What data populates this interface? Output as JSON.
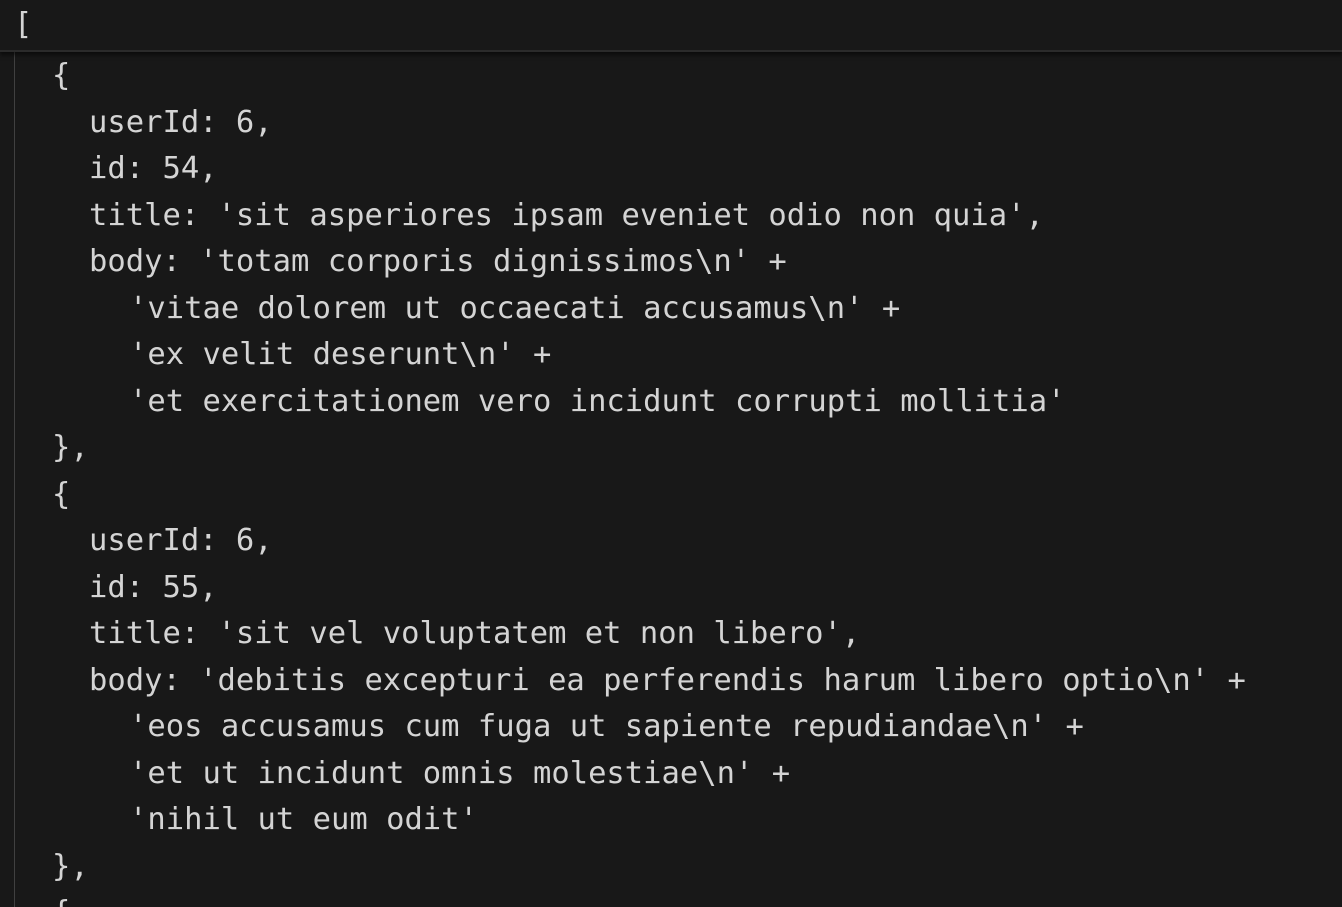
{
  "editor": {
    "sticky_line": "[",
    "lines": [
      "{",
      "userId: 6,",
      "id: 54,",
      "title: 'sit asperiores ipsam eveniet odio non quia',",
      "body: 'totam corporis dignissimos\\n' +",
      "'vitae dolorem ut occaecati accusamus\\n' +",
      "'ex velit deserunt\\n' +",
      "'et exercitationem vero incidunt corrupti mollitia'",
      "},",
      "{",
      "userId: 6,",
      "id: 55,",
      "title: 'sit vel voluptatem et non libero',",
      "body: 'debitis excepturi ea perferendis harum libero optio\\n' +",
      "'eos accusamus cum fuga ut sapiente repudiandae\\n' +",
      "'et ut incidunt omnis molestiae\\n' +",
      "'nihil ut eum odit'",
      "},",
      "{"
    ]
  }
}
